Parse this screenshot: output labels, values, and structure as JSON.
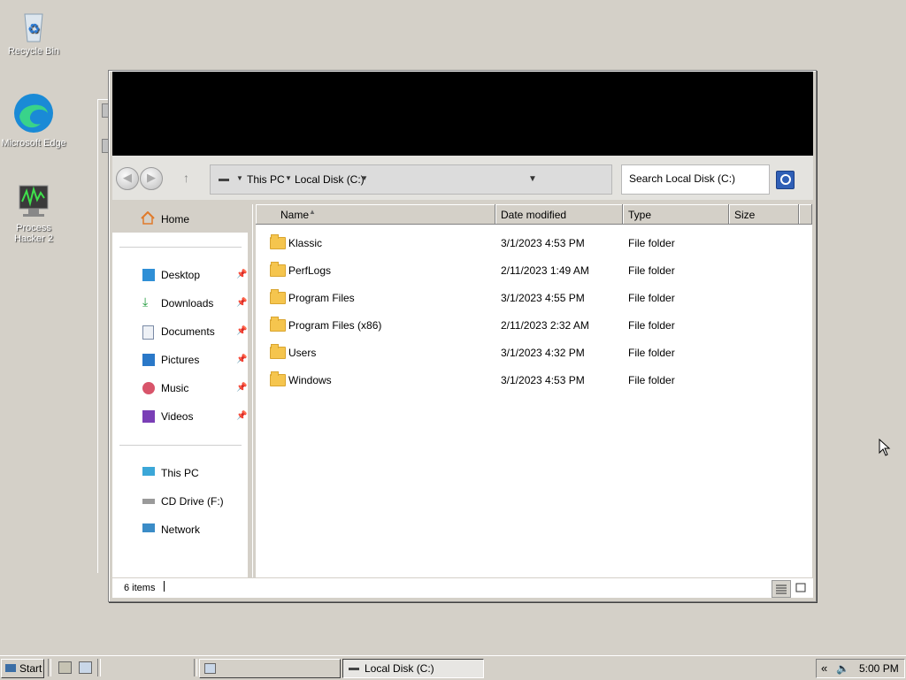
{
  "desktop": {
    "icons": [
      {
        "label": "Recycle Bin",
        "icon": "recycle-bin-icon"
      },
      {
        "label": "Microsoft Edge",
        "icon": "edge-icon"
      },
      {
        "label": "Process Hacker 2",
        "icon": "process-hacker-icon"
      }
    ]
  },
  "explorer": {
    "address": {
      "segments": [
        "This PC",
        "Local Disk (C:)"
      ]
    },
    "search": {
      "placeholder": "Search Local Disk (C:)"
    },
    "sidebar": {
      "home": "Home",
      "quick_access": [
        {
          "label": "Desktop",
          "icon": "desktop-icon",
          "pinned": true
        },
        {
          "label": "Downloads",
          "icon": "downloads-icon",
          "pinned": true
        },
        {
          "label": "Documents",
          "icon": "documents-icon",
          "pinned": true
        },
        {
          "label": "Pictures",
          "icon": "pictures-icon",
          "pinned": true
        },
        {
          "label": "Music",
          "icon": "music-icon",
          "pinned": true
        },
        {
          "label": "Videos",
          "icon": "videos-icon",
          "pinned": true
        }
      ],
      "locations": [
        {
          "label": "This PC",
          "icon": "this-pc-icon"
        },
        {
          "label": "CD Drive (F:)",
          "icon": "cd-drive-icon"
        },
        {
          "label": "Network",
          "icon": "network-icon"
        }
      ]
    },
    "columns": {
      "name": "Name",
      "date": "Date modified",
      "type": "Type",
      "size": "Size"
    },
    "files": [
      {
        "name": "Klassic",
        "date": "3/1/2023 4:53 PM",
        "type": "File folder",
        "size": ""
      },
      {
        "name": "PerfLogs",
        "date": "2/11/2023 1:49 AM",
        "type": "File folder",
        "size": ""
      },
      {
        "name": "Program Files",
        "date": "3/1/2023 4:55 PM",
        "type": "File folder",
        "size": ""
      },
      {
        "name": "Program Files (x86)",
        "date": "2/11/2023 2:32 AM",
        "type": "File folder",
        "size": ""
      },
      {
        "name": "Users",
        "date": "3/1/2023 4:32 PM",
        "type": "File folder",
        "size": ""
      },
      {
        "name": "Windows",
        "date": "3/1/2023 4:53 PM",
        "type": "File folder",
        "size": ""
      }
    ],
    "status": {
      "item_count": "6 items"
    }
  },
  "taskbar": {
    "start_label": "Start",
    "buttons": [
      {
        "label": ""
      },
      {
        "label": "Local Disk (C:)"
      }
    ],
    "clock": "5:00 PM"
  }
}
